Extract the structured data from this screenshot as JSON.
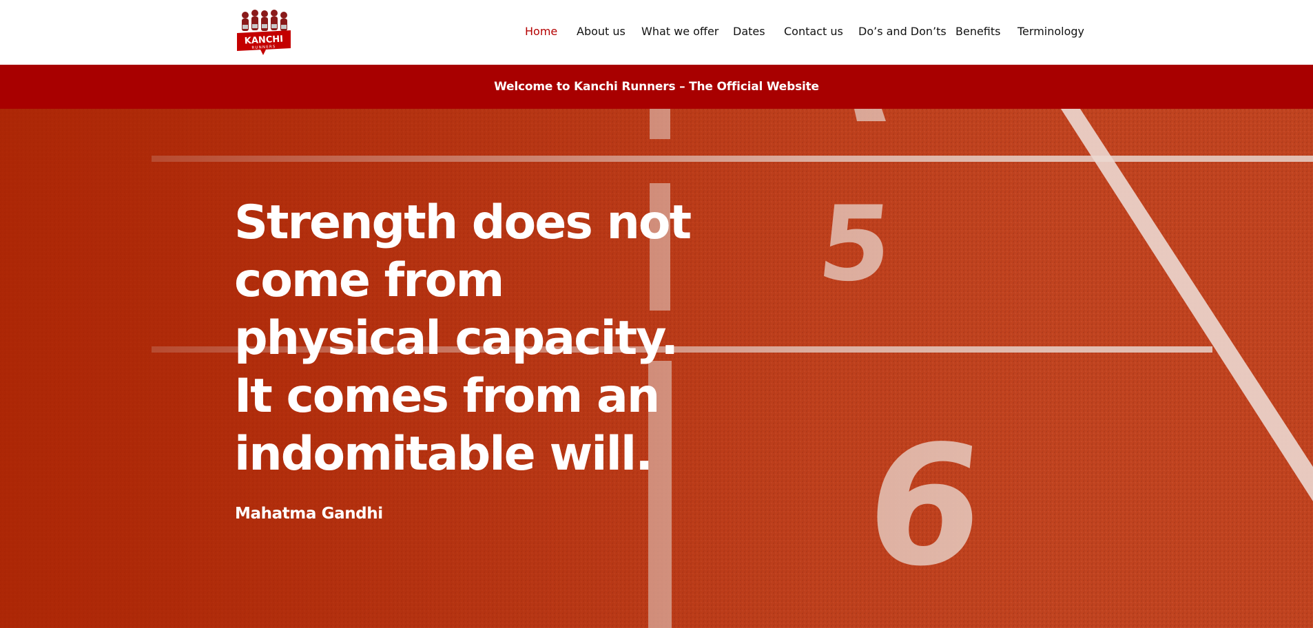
{
  "site": {
    "logo_alt": "Kanchi Runners"
  },
  "nav": {
    "items": [
      {
        "label": "Home",
        "active": true
      },
      {
        "label": "About us",
        "active": false
      },
      {
        "label": "What we offer",
        "active": false
      },
      {
        "label": "Dates",
        "active": false
      },
      {
        "label": "Contact us",
        "active": false
      },
      {
        "label": "Do’s and Don’ts",
        "active": false
      },
      {
        "label": "Benefits",
        "active": false
      },
      {
        "label": "Terminology",
        "active": false
      }
    ]
  },
  "banner": {
    "text": "Welcome to Kanchi Runners – The Official Website"
  },
  "hero": {
    "quote": "Strength does not come from physical capacity. It comes from an indomitable will.",
    "author": "Mahatma Gandhi",
    "lane_numbers": [
      "5",
      "6"
    ]
  },
  "colors": {
    "brand_red": "#a80000",
    "nav_active": "#b40000",
    "track": "#c0431f"
  }
}
